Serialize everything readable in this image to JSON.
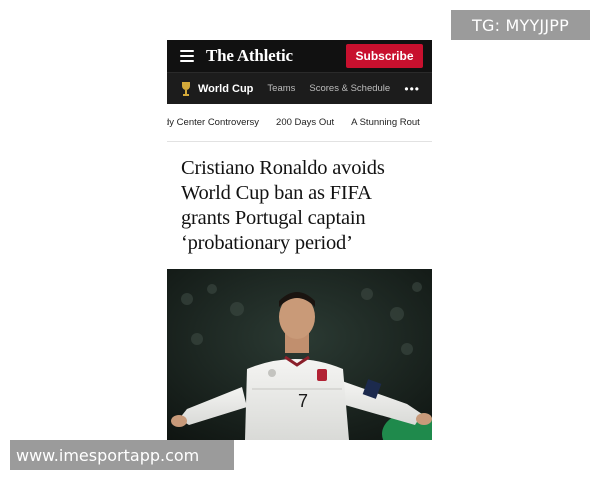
{
  "watermarks": {
    "top_right": "TG: MYYJJPP",
    "bottom_left": "www.imesportapp.com"
  },
  "header": {
    "logo": "The Athletic",
    "subscribe_label": "Subscribe",
    "menu_icon": "hamburger-menu-icon"
  },
  "subnav": {
    "title": "World Cup",
    "icon": "trophy-icon",
    "links": [
      "Teams",
      "Scores & Schedule"
    ],
    "more_icon": "ellipsis-icon",
    "more_glyph": "•••"
  },
  "topics": [
    "dy Center Controversy",
    "200 Days Out",
    "A Stunning Rout"
  ],
  "article": {
    "headline": "Cristiano Ronaldo avoids World Cup ban as FIFA grants Portugal captain ‘probationary period’",
    "jersey_number": "7"
  },
  "colors": {
    "brand_red": "#c8102e",
    "header_bg": "#111111",
    "trophy_gold": "#d4a93a"
  }
}
